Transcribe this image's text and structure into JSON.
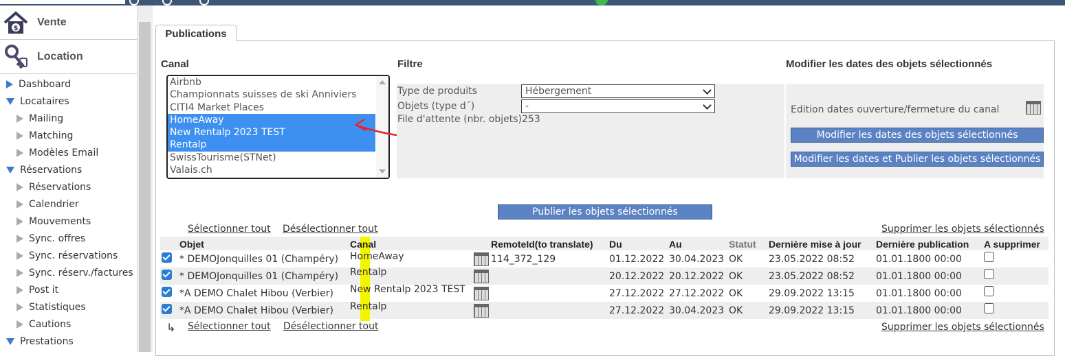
{
  "sidebar": {
    "big": [
      {
        "label": "Vente",
        "icon": "house-dollar-icon"
      },
      {
        "label": "Location",
        "icon": "keys-icon"
      }
    ],
    "items": [
      {
        "label": "Dashboard",
        "level": 0,
        "state": "collapsed"
      },
      {
        "label": "Locataires",
        "level": 0,
        "state": "expanded"
      },
      {
        "label": "Mailing",
        "level": 1,
        "state": "leaf"
      },
      {
        "label": "Matching",
        "level": 1,
        "state": "leaf"
      },
      {
        "label": "Modèles Email",
        "level": 1,
        "state": "leaf"
      },
      {
        "label": "Réservations",
        "level": 0,
        "state": "expanded"
      },
      {
        "label": "Réservations",
        "level": 1,
        "state": "leaf"
      },
      {
        "label": "Calendrier",
        "level": 1,
        "state": "leaf"
      },
      {
        "label": "Mouvements",
        "level": 1,
        "state": "leaf"
      },
      {
        "label": "Sync. offres",
        "level": 1,
        "state": "leaf"
      },
      {
        "label": "Sync. réservations",
        "level": 1,
        "state": "leaf"
      },
      {
        "label": "Sync. réserv./factures",
        "level": 1,
        "state": "leaf"
      },
      {
        "label": "Post it",
        "level": 1,
        "state": "leaf"
      },
      {
        "label": "Statistiques",
        "level": 1,
        "state": "leaf"
      },
      {
        "label": "Cautions",
        "level": 1,
        "state": "leaf"
      },
      {
        "label": "Prestations",
        "level": 0,
        "state": "expanded"
      }
    ]
  },
  "tab": {
    "label": "Publications"
  },
  "canal": {
    "title": "Canal",
    "options": [
      {
        "label": "Airbnb",
        "selected": false
      },
      {
        "label": "Championnats suisses de ski Anniviers",
        "selected": false
      },
      {
        "label": "CITI4 Market Places",
        "selected": false
      },
      {
        "label": "HomeAway",
        "selected": true
      },
      {
        "label": "New Rentalp 2023 TEST",
        "selected": true
      },
      {
        "label": "Rentalp",
        "selected": true
      },
      {
        "label": "SwissTourisme(STNet)",
        "selected": false
      },
      {
        "label": "Valais.ch",
        "selected": false
      }
    ]
  },
  "filtre": {
    "title": "Filtre",
    "type_label": "Type de produits",
    "type_value": "Hébergement",
    "objets_label": "Objets (type d´)",
    "objets_value": "-",
    "queue_label": "File d'attente (nbr. objets)",
    "queue_value": "253"
  },
  "dates": {
    "title": "Modifier les dates des objets sélectionnés",
    "edition_label": "Edition dates ouverture/fermeture du canal",
    "btn_modify": "Modifier les dates des objets sélectionnés",
    "btn_modify_publish": "Modifier les dates et Publier les objets sélectionnés"
  },
  "publish_button": "Publier les objets sélectionnés",
  "links": {
    "select_all": "Sélectionner tout",
    "deselect_all": "Désélectionner tout",
    "delete_selected": "Supprimer  les objets sélectionnés"
  },
  "table": {
    "headers": [
      "Objet",
      "Canal",
      "RemoteId(to translate)",
      "Du",
      "Au",
      "Statut",
      "Dernière mise à jour",
      "Dernière publication",
      "A supprimer"
    ],
    "rows": [
      {
        "checked": true,
        "objet": "* DEMOJonquilles 01 (Champéry)",
        "canal": "HomeAway",
        "remote": "114_372_129",
        "du": "01.12.2022",
        "au": "30.04.2023",
        "statut": "OK",
        "maj": "23.05.2022 08:52",
        "pub": "01.01.1800 00:00",
        "del": false
      },
      {
        "checked": true,
        "objet": "* DEMOJonquilles 01 (Champéry)",
        "canal": "Rentalp",
        "remote": "",
        "du": "20.12.2022",
        "au": "20.12.2022",
        "statut": "OK",
        "maj": "23.05.2022 08:52",
        "pub": "01.01.1800 00:00",
        "del": false
      },
      {
        "checked": true,
        "objet": "*A DEMO Chalet Hibou (Verbier)",
        "canal": "New Rentalp 2023 TEST",
        "remote": "",
        "du": "27.12.2022",
        "au": "27.12.2022",
        "statut": "OK",
        "maj": "29.09.2022 13:15",
        "pub": "01.01.1800 00:00",
        "del": false
      },
      {
        "checked": true,
        "objet": "*A DEMO Chalet Hibou (Verbier)",
        "canal": "Rentalp",
        "remote": "",
        "du": "27.12.2022",
        "au": "30.04.2023",
        "statut": "OK",
        "maj": "29.09.2022 13:15",
        "pub": "01.01.1800 00:00",
        "del": false
      }
    ]
  },
  "colors": {
    "accent": "#3d8ff0",
    "button": "#5b82c2",
    "annotation": "#e8232a",
    "highlight": "#f3f500"
  }
}
